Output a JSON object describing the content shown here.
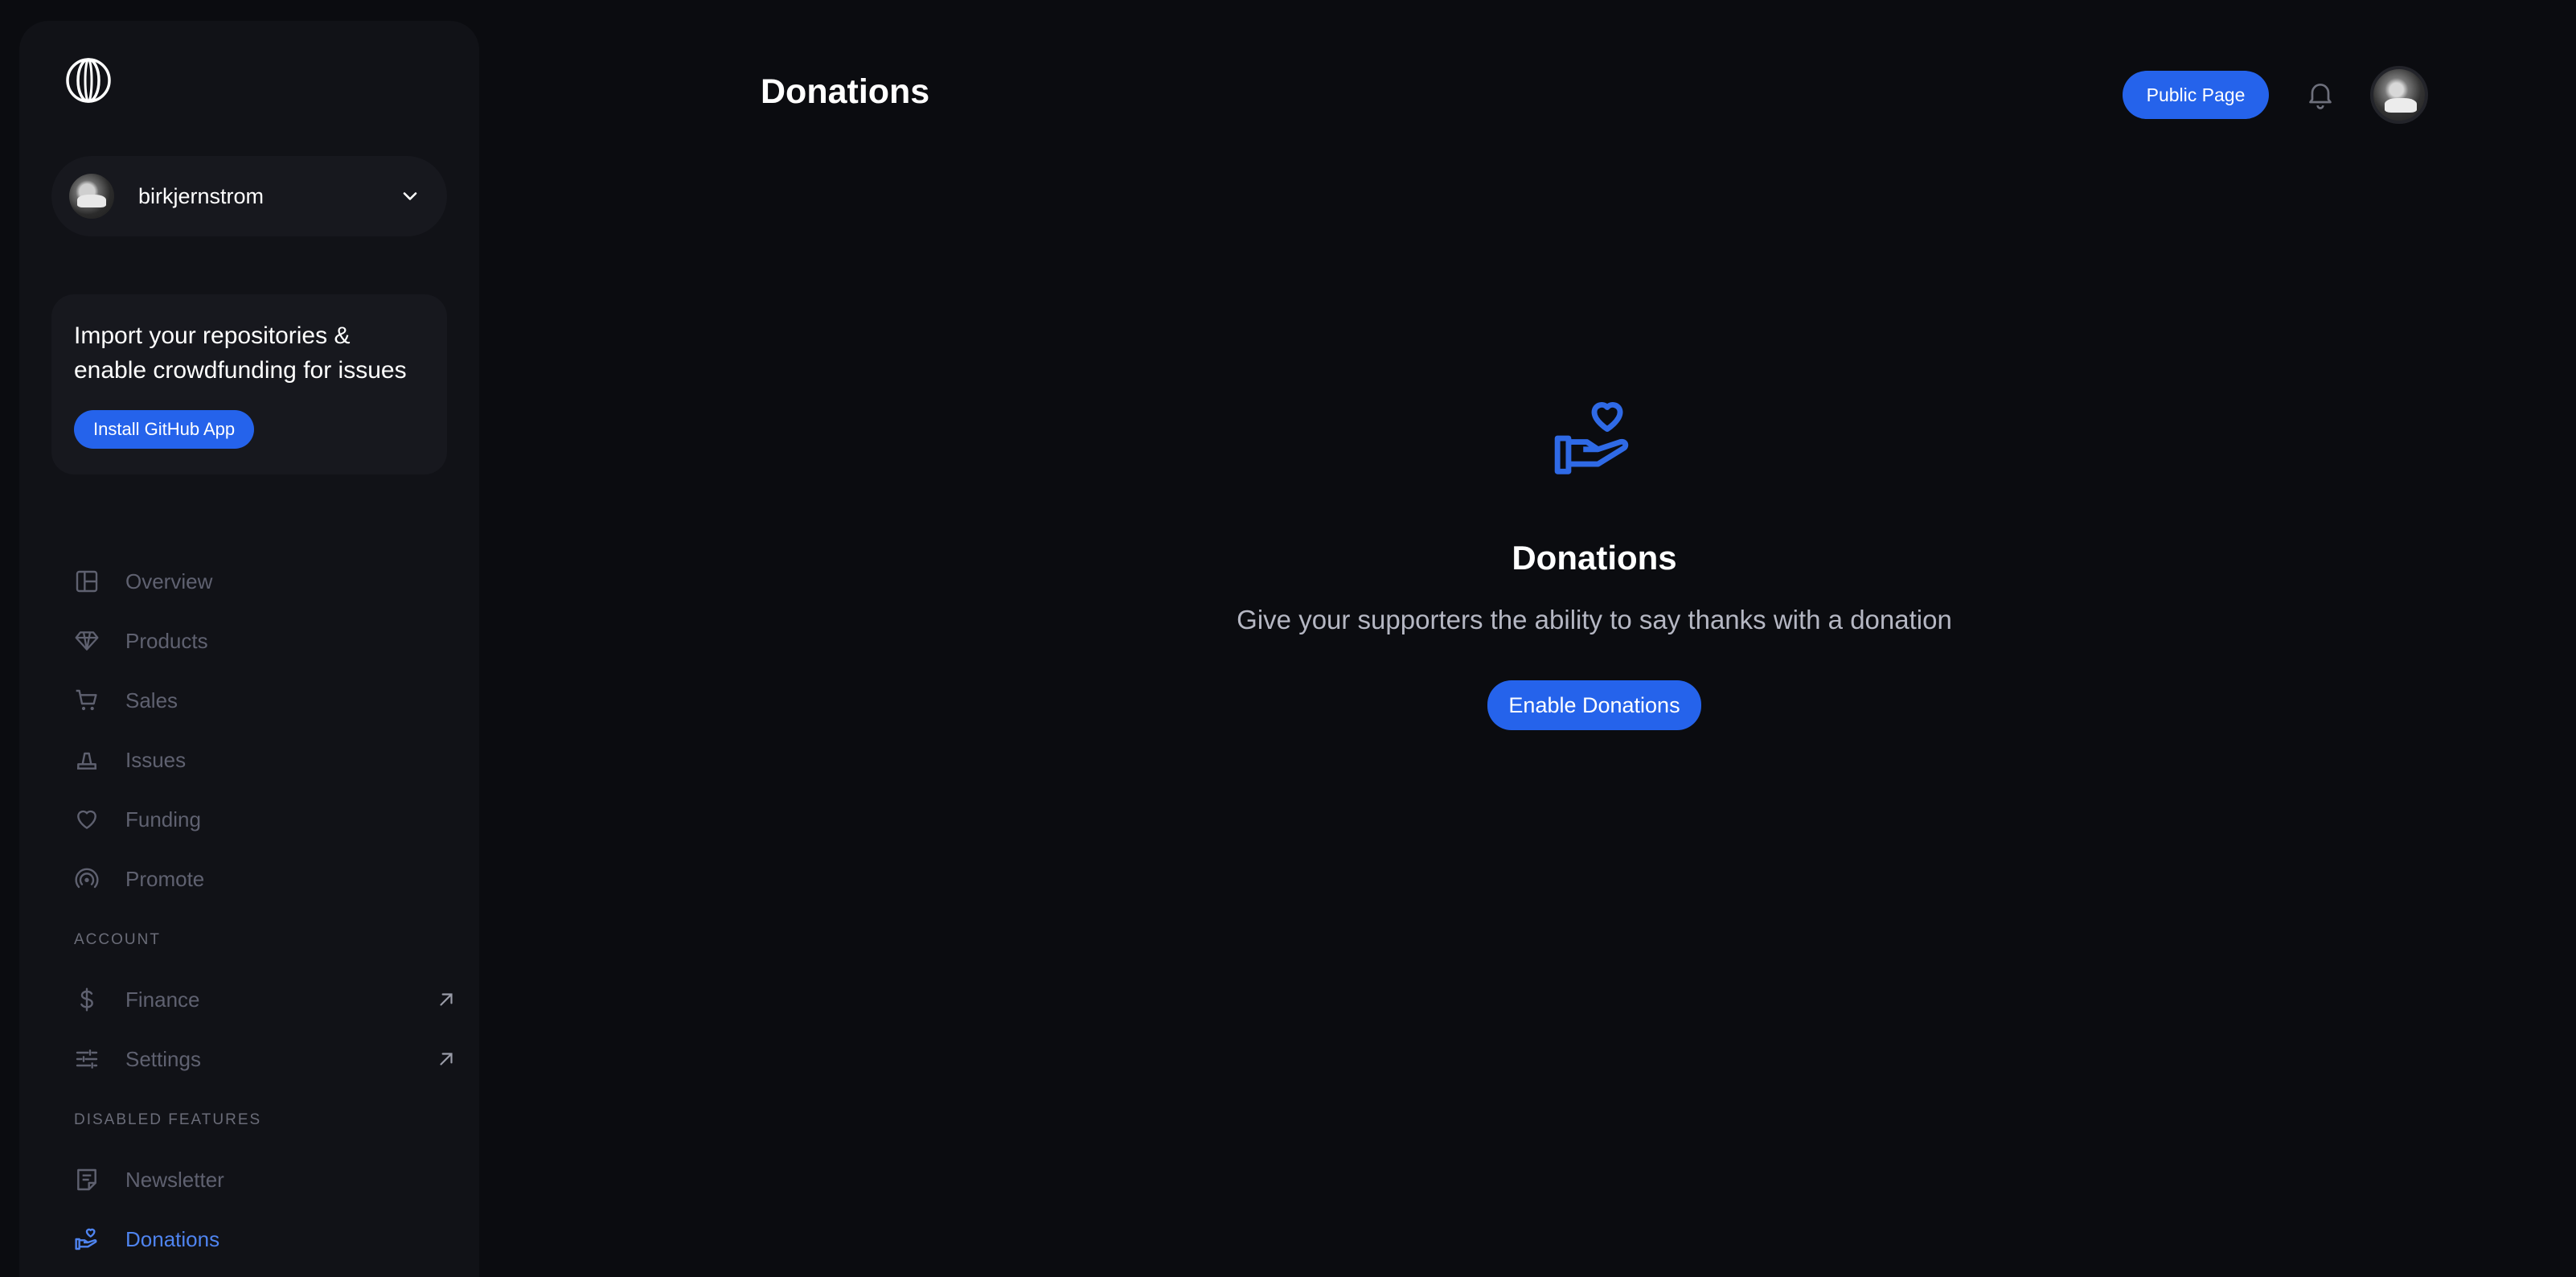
{
  "sidebar": {
    "account": {
      "name": "birkjernstrom"
    },
    "promo": {
      "title": "Import your repositories & enable crowdfunding for issues",
      "button_label": "Install GitHub App"
    },
    "nav_items": [
      {
        "label": "Overview",
        "icon": "layout-icon"
      },
      {
        "label": "Products",
        "icon": "diamond-icon"
      },
      {
        "label": "Sales",
        "icon": "cart-icon"
      },
      {
        "label": "Issues",
        "icon": "issues-icon"
      },
      {
        "label": "Funding",
        "icon": "heart-icon"
      },
      {
        "label": "Promote",
        "icon": "broadcast-icon"
      }
    ],
    "account_section": {
      "label": "ACCOUNT",
      "items": [
        {
          "label": "Finance",
          "icon": "dollar-icon"
        },
        {
          "label": "Settings",
          "icon": "sliders-icon"
        }
      ]
    },
    "disabled_section": {
      "label": "DISABLED FEATURES",
      "items": [
        {
          "label": "Newsletter",
          "icon": "document-icon"
        },
        {
          "label": "Donations",
          "icon": "hand-heart-icon",
          "active": true
        }
      ]
    }
  },
  "header": {
    "title": "Donations",
    "public_page_label": "Public Page"
  },
  "empty_state": {
    "title": "Donations",
    "subtitle": "Give your supporters the ability to say thanks with a donation",
    "button_label": "Enable Donations"
  },
  "colors": {
    "accent": "#2563eb",
    "active_nav": "#4f84f0",
    "background": "#0b0c10",
    "sidebar": "#111217"
  }
}
